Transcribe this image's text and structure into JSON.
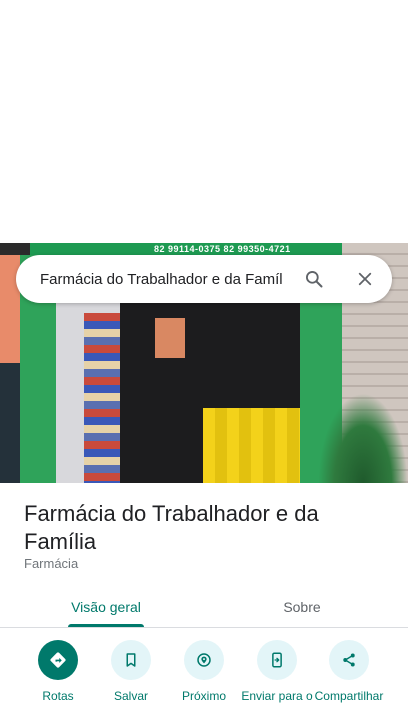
{
  "search": {
    "query": "Farmácia do Trabalhador e da Famíl"
  },
  "photo": {
    "sign_text": "82 99114-0375   82 99350-4721"
  },
  "place": {
    "name": "Farmácia do Trabalhador e da Família",
    "category": "Farmácia"
  },
  "tabs": [
    {
      "label": "Visão geral",
      "active": true
    },
    {
      "label": "Sobre",
      "active": false
    }
  ],
  "actions": [
    {
      "label": "Rotas",
      "icon": "directions-icon"
    },
    {
      "label": "Salvar",
      "icon": "bookmark-icon"
    },
    {
      "label": "Próximo",
      "icon": "nearby-icon"
    },
    {
      "label": "Enviar para o",
      "icon": "send-to-phone-icon"
    },
    {
      "label": "Compartilhar",
      "icon": "share-icon"
    }
  ],
  "colors": {
    "accent": "#00796b",
    "chip_bg": "#e3f5f8",
    "text": "#202124",
    "secondary_text": "#70757a"
  }
}
